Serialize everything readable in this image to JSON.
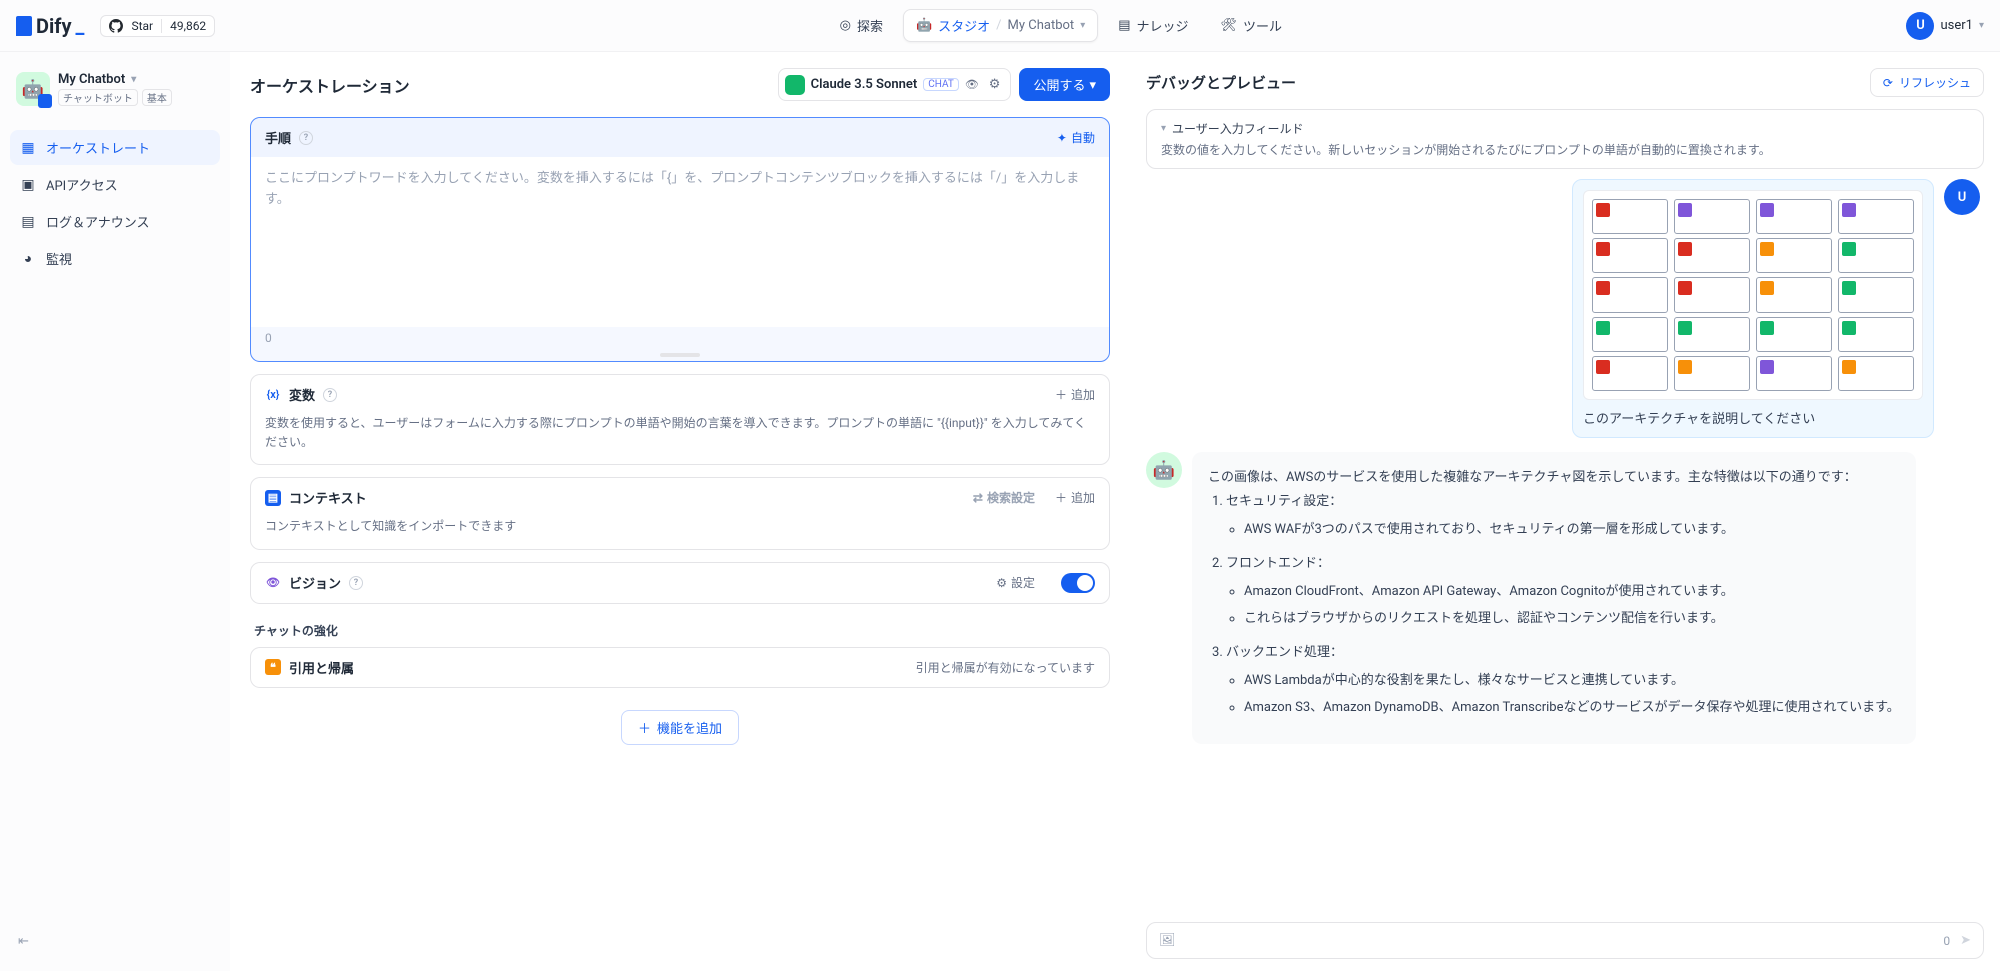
{
  "header": {
    "logo_text": "Dify",
    "gh_star_label": "Star",
    "gh_star_count": "49,862",
    "nav": {
      "explore": "探索",
      "studio": "スタジオ",
      "knowledge": "ナレッジ",
      "tools": "ツール",
      "current_app": "My Chatbot"
    },
    "user": {
      "initial": "U",
      "name": "user1"
    }
  },
  "sidebar": {
    "app": {
      "name": "My Chatbot",
      "tag1": "チャットボット",
      "tag2": "基本"
    },
    "items": {
      "orchestrate": "オーケストレート",
      "api": "APIアクセス",
      "logs": "ログ＆アナウンス",
      "monitor": "監視"
    }
  },
  "orchestration": {
    "title": "オーケストレーション",
    "model": {
      "name": "Claude 3.5 Sonnet",
      "chat_badge": "CHAT"
    },
    "publish_btn": "公開する",
    "prompt": {
      "label": "手順",
      "auto": "自動",
      "placeholder": "ここにプロンプトワードを入力してください。変数を挿入するには「{」を、プロンプトコンテンツブロックを挿入するには「/」を入力します。",
      "char_count": "0"
    },
    "variables": {
      "label": "変数",
      "add": "追加",
      "desc": "変数を使用すると、ユーザーはフォームに入力する際にプロンプトの単語や開始の言葉を導入できます。プロンプトの単語に \"{{input}}\" を入力してみてください。"
    },
    "context": {
      "label": "コンテキスト",
      "search": "検索設定",
      "add": "追加",
      "desc": "コンテキストとして知識をインポートできます"
    },
    "vision": {
      "label": "ビジョン",
      "settings": "設定"
    },
    "enhance_label": "チャットの強化",
    "citation": {
      "label": "引用と帰属",
      "status": "引用と帰属が有効になっています"
    },
    "add_feature": "機能を追加"
  },
  "preview": {
    "title": "デバッグとプレビュー",
    "refresh": "リフレッシュ",
    "input_fields": {
      "title": "ユーザー入力フィールド",
      "desc": "変数の値を入力してください。新しいセッションが開始されるたびにプロンプトの単語が自動的に置換されます。"
    },
    "user_msg": "このアーキテクチャを説明してください",
    "assistant_msg": {
      "intro": "この画像は、AWSのサービスを使用した複雑なアーキテクチャ図を示しています。主な特徴は以下の通りです：",
      "h1": "セキュリティ設定：",
      "h1_b1": "AWS WAFが3つのパスで使用されており、セキュリティの第一層を形成しています。",
      "h2": "フロントエンド：",
      "h2_b1": "Amazon CloudFront、Amazon API Gateway、Amazon Cognitoが使用されています。",
      "h2_b2": "これらはブラウザからのリクエストを処理し、認証やコンテンツ配信を行います。",
      "h3": "バックエンド処理：",
      "h3_b1": "AWS Lambdaが中心的な役割を果たし、様々なサービスと連携しています。",
      "h3_b2": "Amazon S3、Amazon DynamoDB、Amazon Transcribeなどのサービスがデータ保存や処理に使用されています。"
    },
    "user_initial": "U",
    "input_count": "0"
  }
}
